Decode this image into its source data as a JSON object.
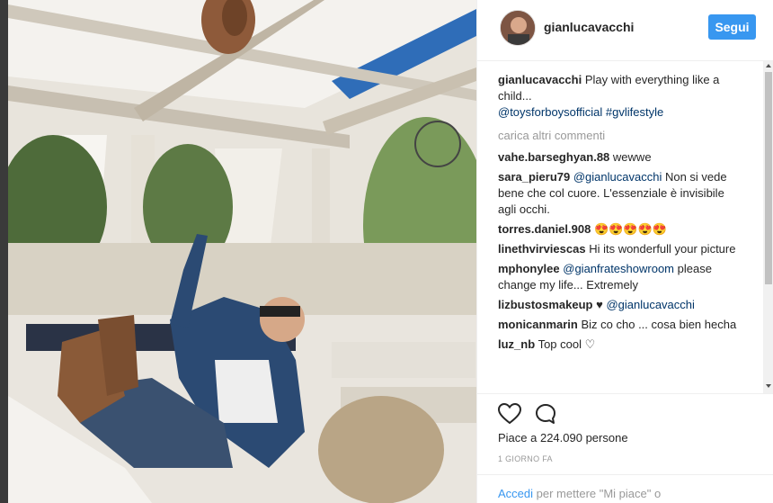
{
  "header": {
    "username": "gianlucavacchi",
    "follow_label": "Segui"
  },
  "post": {
    "caption_user": "gianlucavacchi",
    "caption_text": "Play with everything like a child...",
    "caption_mention": "@toysforboysofficial",
    "caption_hashtag": "#gvlifestyle"
  },
  "load_more_label": "carica altri commenti",
  "comments": [
    {
      "user": "vahe.barseghyan.88",
      "text": "wewwe"
    },
    {
      "user": "sara_pieru79",
      "mention": "@gianlucavacchi",
      "text": "Non si vede bene che col cuore. L'essenziale è invisibile agli occhi."
    },
    {
      "user": "torres.daniel.908",
      "text": "😍😍😍😍😍"
    },
    {
      "user": "linethvirviescas",
      "text": "Hi its wonderfull your picture"
    },
    {
      "user": "mphonylee",
      "mention": "@gianfrateshowroom",
      "text": "please change my life... Extremely"
    },
    {
      "user": "lizbustosmakeup",
      "text": "♥",
      "mention": "@gianlucavacchi"
    },
    {
      "user": "monicanmarin",
      "text": "Biz co cho ... cosa bien hecha"
    },
    {
      "user": "luz_nb",
      "text": "Top cool ♡"
    }
  ],
  "actions": {
    "like_icon": "heart-icon",
    "comment_icon": "speech-bubble-icon"
  },
  "likes_text": "Piace a 224.090 persone",
  "date_text": "1 GIORNO FA",
  "footer": {
    "login_label": "Accedi",
    "rest_text": "per mettere \"Mi piace\" o"
  },
  "colors": {
    "accent": "#3897f0",
    "link": "#003569",
    "muted": "#999999"
  }
}
